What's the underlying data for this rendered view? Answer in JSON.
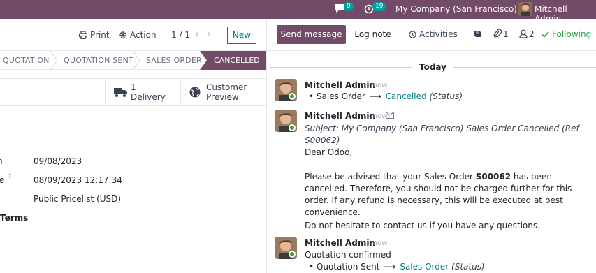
{
  "navbar": {
    "chat_count": "9",
    "activity_count": "19",
    "company": "My Company (San Francisco)",
    "user": "Mitchell Admin"
  },
  "control_panel": {
    "print_label": "Print",
    "action_label": "Action",
    "pager": "1 / 1",
    "new_label": "New"
  },
  "statusbar": {
    "stages": [
      "QUOTATION",
      "QUOTATION SENT",
      "SALES ORDER",
      "CANCELLED"
    ],
    "active": "CANCELLED"
  },
  "smart_buttons": {
    "delivery_count": "1",
    "delivery_label": "Delivery",
    "preview_line1": "Customer",
    "preview_line2": "Preview"
  },
  "form": {
    "fields": [
      {
        "label": "n",
        "value": "09/08/2023"
      },
      {
        "label": "te",
        "value": "08/09/2023 12:17:34"
      },
      {
        "label": "",
        "value": "Public Pricelist (USD)"
      }
    ],
    "tooltip_mark": "?",
    "terms_label": "Terms"
  },
  "chatter": {
    "send_message": "Send message",
    "log_note": "Log note",
    "activities": "Activities",
    "attachments_count": "1",
    "followers_count": "2",
    "following": "Following",
    "today": "Today",
    "messages": [
      {
        "author": "Mitchell Admin",
        "date": "- now",
        "tracking": {
          "field": "Sales Order",
          "new": "Cancelled",
          "name": "(Status)"
        }
      },
      {
        "author": "Mitchell Admin",
        "date": "- now",
        "subject": "Subject: My Company (San Francisco) Sales Order Cancelled (Ref S00062)",
        "greeting": "Dear Odoo,",
        "para1_a": "Please be advised that your Sales Order ",
        "para1_ref": "S00062",
        "para1_b": " has been cancelled. Therefore, you should not be charged further for this order. If any refund is necessary, this will be executed at best convenience.",
        "para2": "Do not hesitate to contact us if you have any questions."
      },
      {
        "author": "Mitchell Admin",
        "date": "- now",
        "body": "Quotation confirmed",
        "tracking": {
          "field": "Quotation Sent",
          "new": "Sales Order",
          "name": "(Status)"
        }
      }
    ]
  },
  "colors": {
    "brand": "#714b67",
    "accent": "#017e84",
    "success": "#28a745"
  }
}
